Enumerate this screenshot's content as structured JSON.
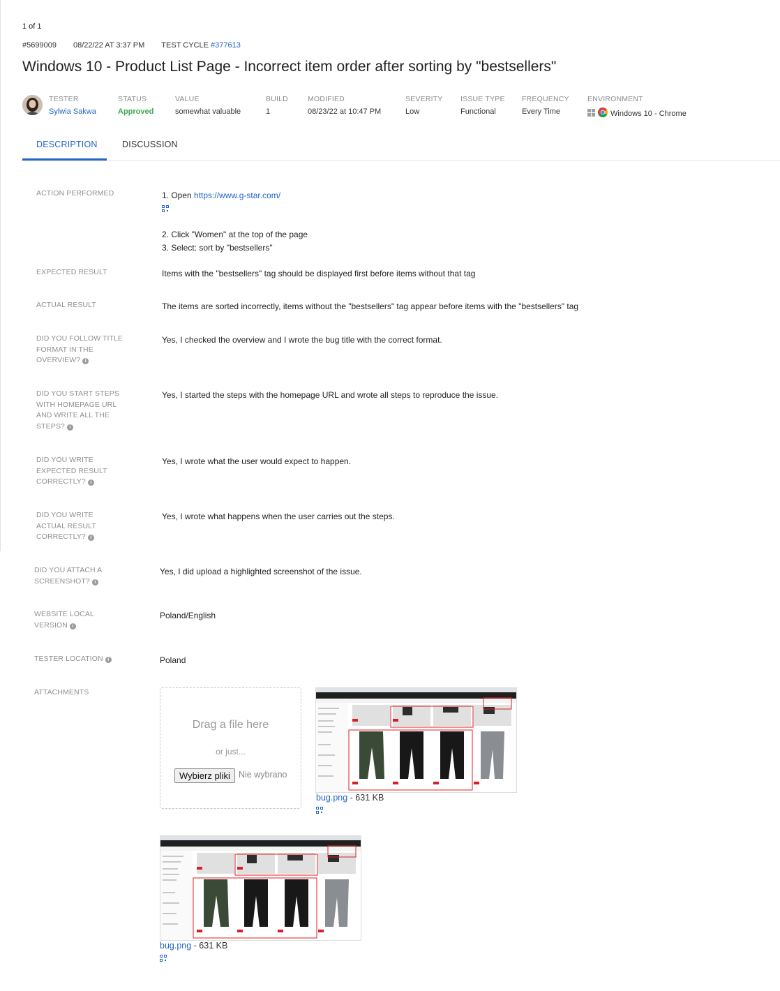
{
  "pager": "1 of 1",
  "header": {
    "issue_id": "#5699009",
    "date": "08/22/22 AT 3:37 PM",
    "test_cycle_label": "TEST CYCLE ",
    "test_cycle_link": "#377613",
    "title": "Windows 10 - Product List Page - Incorrect item order after sorting by \"bestsellers\""
  },
  "info": {
    "tester": {
      "label": "TESTER",
      "value": "Sylwia Sakwa"
    },
    "status": {
      "label": "STATUS",
      "value": "Approved"
    },
    "value": {
      "label": "VALUE",
      "value": "somewhat valuable"
    },
    "build": {
      "label": "BUILD",
      "value": "1"
    },
    "modified": {
      "label": "MODIFIED",
      "value": "08/23/22 at 10:47 PM"
    },
    "severity": {
      "label": "SEVERITY",
      "value": "Low"
    },
    "issue_type": {
      "label": "ISSUE TYPE",
      "value": "Functional"
    },
    "frequency": {
      "label": "FREQUENCY",
      "value": "Every Time"
    },
    "environment": {
      "label": "ENVIRONMENT",
      "value": "Windows 10 - Chrome"
    }
  },
  "tabs": [
    "DESCRIPTION",
    "DISCUSSION"
  ],
  "rows": {
    "action": {
      "label": "ACTION PERFORMED",
      "step1_prefix": "1. Open ",
      "step1_link": "https://www.g-star.com/",
      "step2": "2. Click \"Women\" at the top of the page",
      "step3": "3. Select: sort by \"bestsellers\""
    },
    "expected": {
      "label": "EXPECTED RESULT",
      "value": "Items with the \"bestsellers\" tag should be displayed first before items without that tag"
    },
    "actual": {
      "label": "ACTUAL RESULT",
      "value": "The items are sorted incorrectly, items without the \"bestsellers\" tag appear before items with the \"bestsellers\" tag"
    },
    "q_title": {
      "label": "DID YOU FOLLOW TITLE FORMAT IN THE OVERVIEW?",
      "value": "Yes, I checked the overview and I wrote the bug title with the correct format."
    },
    "q_steps": {
      "label": "DID YOU START STEPS WITH HOMEPAGE URL AND WRITE ALL THE STEPS?",
      "value": "Yes, I started the steps with the homepage URL and wrote all steps to reproduce the issue."
    },
    "q_expected": {
      "label": "DID YOU WRITE EXPECTED RESULT CORRECTLY?",
      "value": "Yes, I wrote what the user would expect to happen."
    },
    "q_actual": {
      "label": "DID YOU WRITE ACTUAL RESULT CORRECTLY?",
      "value": "Yes, I wrote what happens when the user carries out the steps."
    },
    "q_screenshot": {
      "label": "DID YOU ATTACH A SCREENSHOT?",
      "value": "Yes, I did upload a highlighted screenshot of the issue."
    },
    "local_version": {
      "label": "WEBSITE LOCAL VERSION",
      "value": "Poland/English"
    },
    "location": {
      "label": "TESTER LOCATION",
      "value": "Poland"
    },
    "attachments": {
      "label": "ATTACHMENTS"
    }
  },
  "dropzone": {
    "drag_text": "Drag a file here",
    "or_text": "or just...",
    "button_label": "Wybierz pliki",
    "no_file": "Nie wybrano pliku"
  },
  "attachments": [
    {
      "name": "bug.png",
      "size": " - 631 KB"
    },
    {
      "name": "bug.png",
      "size": " - 631 KB"
    }
  ],
  "colors": {
    "link": "#2366c4",
    "approved": "#3aa84f",
    "highlight": "#e01f26"
  },
  "icons": [
    "info-icon",
    "qr-code-icon",
    "windows-icon",
    "chrome-icon"
  ]
}
